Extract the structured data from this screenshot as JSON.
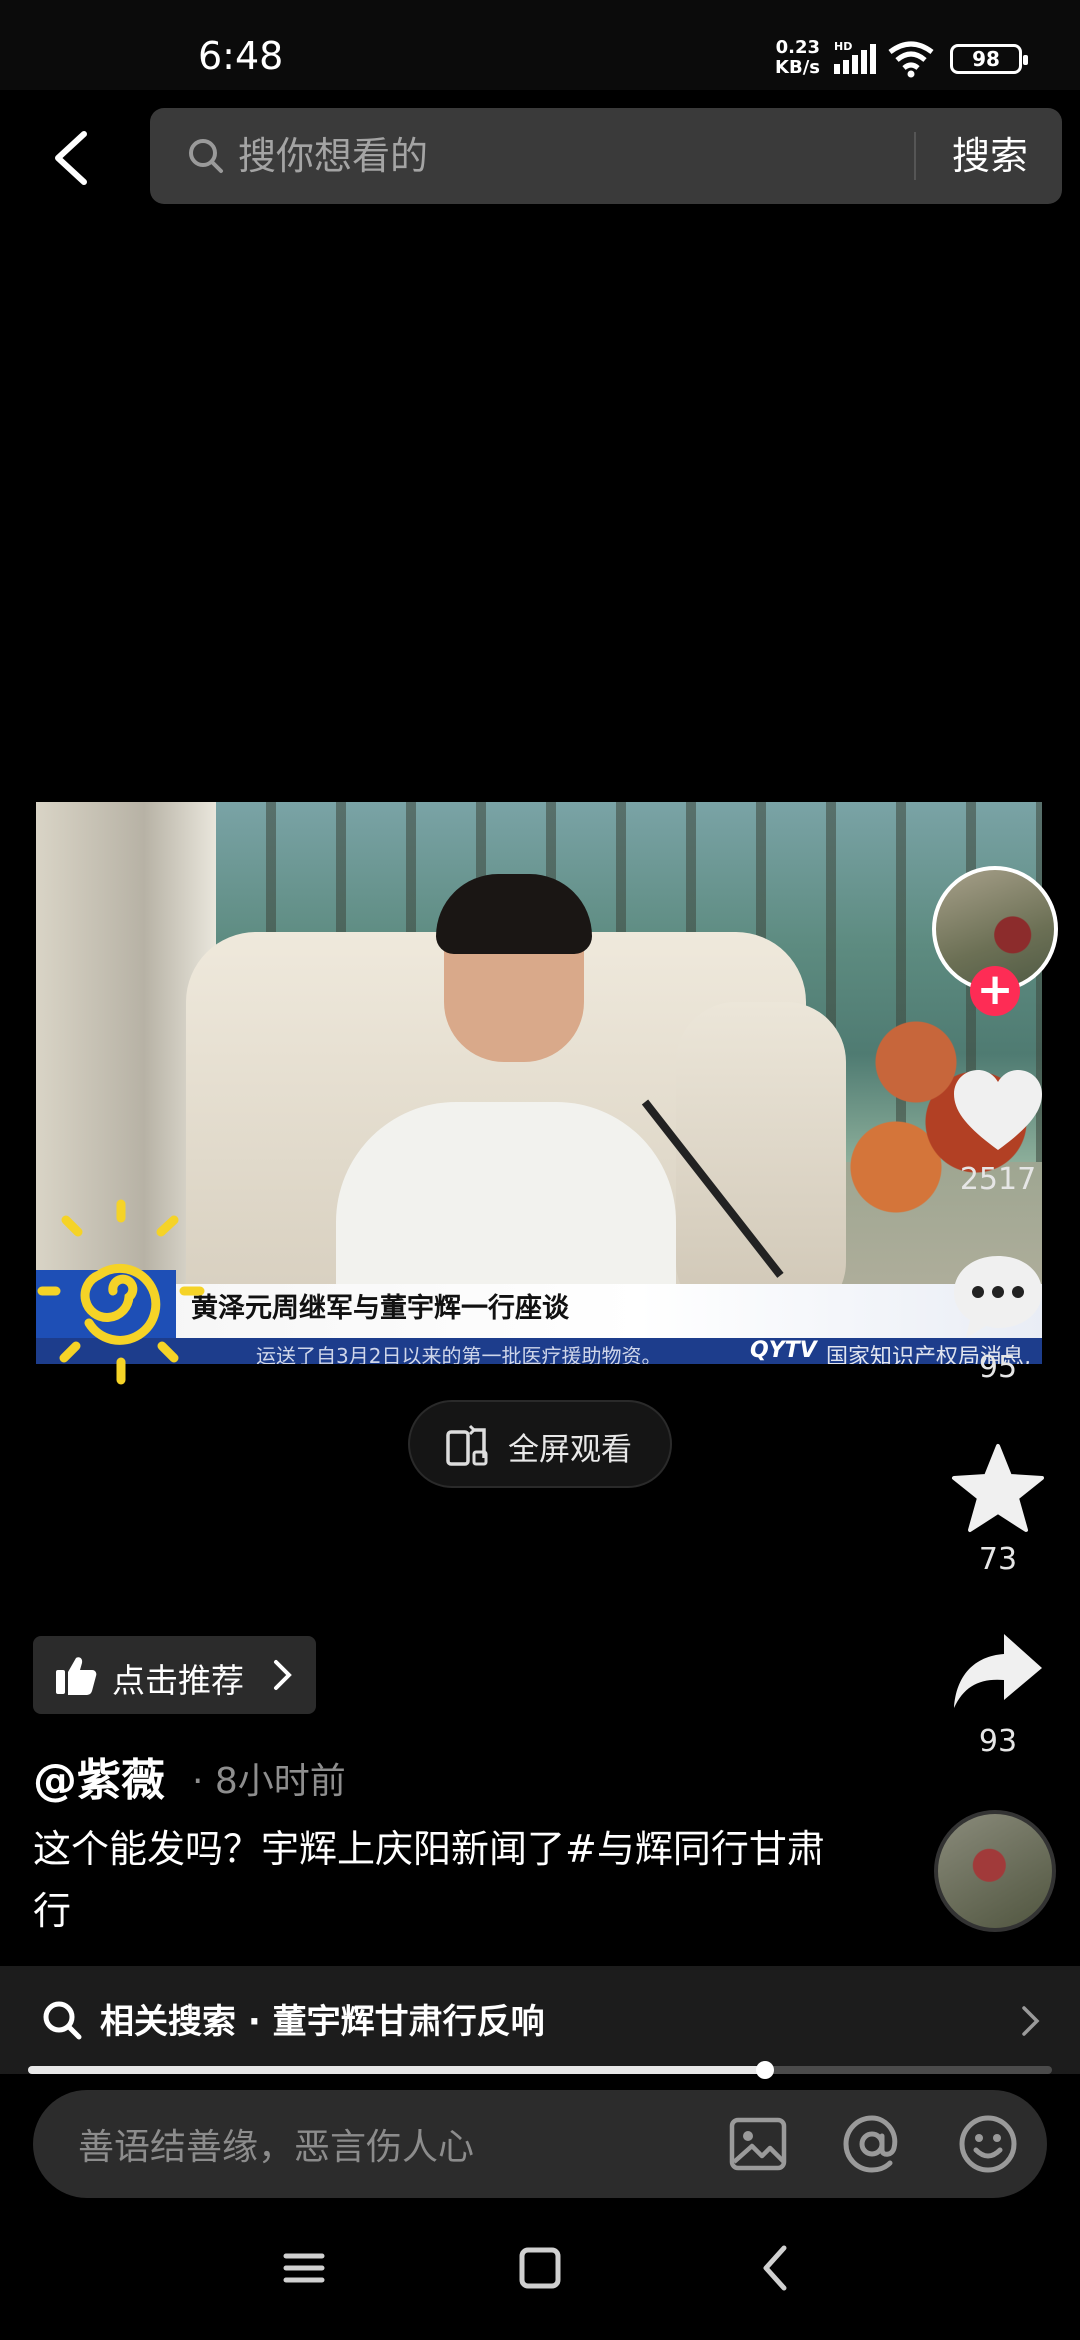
{
  "status": {
    "time": "6:48",
    "net_speed_top": "0.23",
    "net_speed_unit": "KB/s",
    "net_type": "HD",
    "battery": "98"
  },
  "search": {
    "placeholder": "搜你想看的",
    "button": "搜索"
  },
  "video": {
    "ticker_title": "黄泽元周继军与董宇辉一行座谈",
    "ticker_sub": "运送了自3月2日以来的第一批医疗援助物资。",
    "channel": "QYTV",
    "ticker_right": "国家知识产权局消息,",
    "progress": 0.72
  },
  "fullscreen": {
    "label": "全屏观看"
  },
  "rail": {
    "likes": "2517",
    "comments": "95",
    "favorites": "73",
    "shares": "93"
  },
  "recommend": {
    "label": "点击推荐"
  },
  "post": {
    "author": "@紫薇",
    "time_ago": "· 8小时前",
    "description": "这个能发吗？宇辉上庆阳新闻了#与辉同行甘肃行"
  },
  "related": {
    "text": "相关搜索 · 董宇辉甘肃行反响"
  },
  "comment": {
    "placeholder": "善语结善缘，恶言伤人心"
  }
}
